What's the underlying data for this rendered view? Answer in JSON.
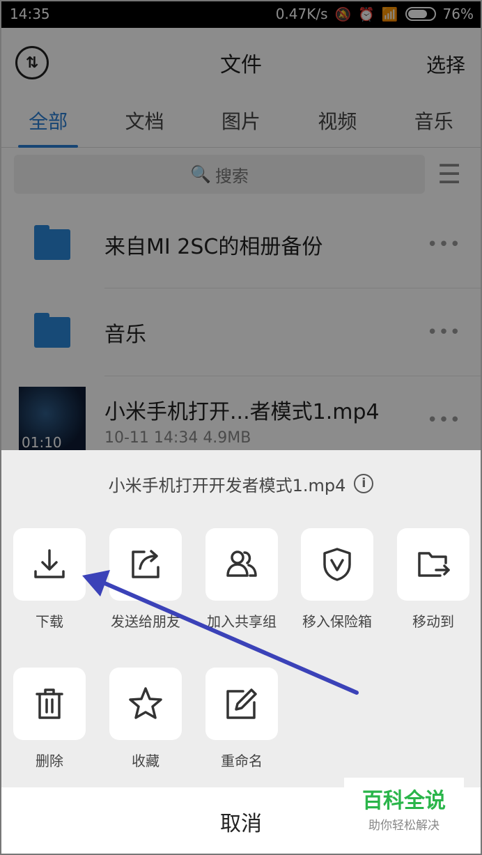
{
  "status_bar": {
    "time": "14:35",
    "speed": "0.47K/s",
    "battery": "76%"
  },
  "header": {
    "title": "文件",
    "select_label": "选择"
  },
  "tabs": [
    "全部",
    "文档",
    "图片",
    "视频",
    "音乐"
  ],
  "search": {
    "label": "搜索"
  },
  "files": [
    {
      "name": "来自MI 2SC的相册备份"
    },
    {
      "name": "音乐"
    },
    {
      "name": "小米手机打开...者模式1.mp4",
      "meta": "10-11 14:34  4.9MB",
      "duration": "01:10"
    }
  ],
  "sheet": {
    "file_name": "小米手机打开开发者模式1.mp4",
    "actions": [
      "下载",
      "发送给朋友",
      "加入共享组",
      "移入保险箱",
      "移动到",
      "删除",
      "收藏",
      "重命名"
    ],
    "cancel_label": "取消"
  },
  "watermark": {
    "title": "百科全说",
    "subtitle": "助你轻松解决"
  },
  "colors": {
    "accent": "#2a7fd4",
    "arrow": "#3b42b8",
    "watermark": "#2ab54a"
  }
}
